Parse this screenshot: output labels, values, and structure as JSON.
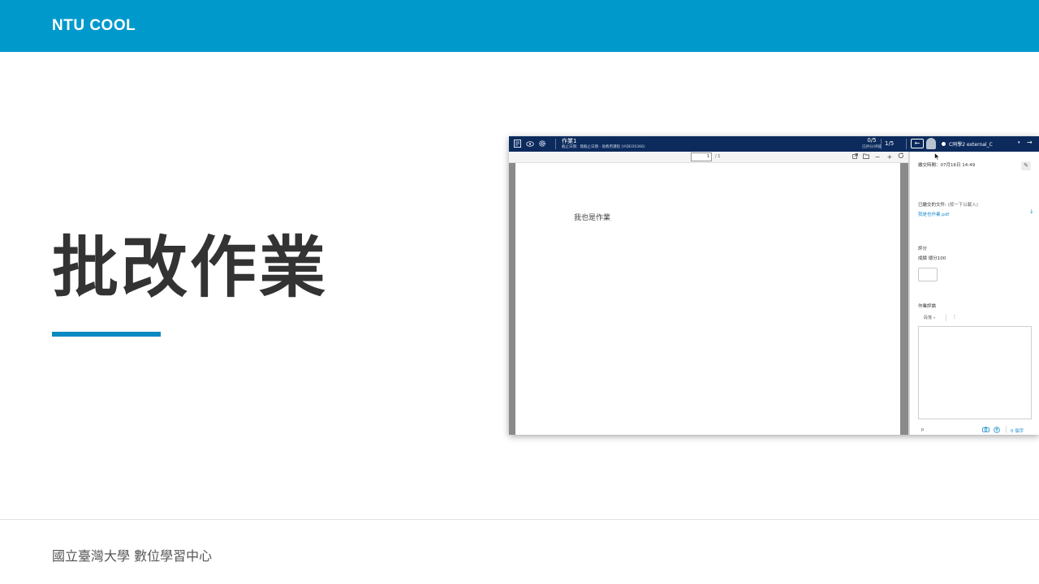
{
  "brand": "NTU COOL",
  "slide": {
    "title": "批改作業",
    "footer": "國立臺灣大學 數位學習中心"
  },
  "screenshot": {
    "header": {
      "icons": [
        "gradebook-icon",
        "eye-icon",
        "settings-icon"
      ],
      "assignment_title": "作業1",
      "assignment_subtitle": "截止日期：無截止日期 - 助教用課程 (VIDEO0366)",
      "graded_count": "0/5",
      "graded_label": "已評分/評論",
      "position": "1/5",
      "prev_arrow": "←",
      "student_name": "C同學2 external_C",
      "student_dropdown": "▾",
      "next_arrow": "→"
    },
    "viewer": {
      "page_input": "1",
      "page_total": "/ 1",
      "toolbar_icons": [
        "open-external-icon",
        "folder-icon",
        "zoom-out-icon",
        "zoom-in-icon",
        "rotate-icon"
      ],
      "document_text": "我也是作業"
    },
    "panel": {
      "submitted_time_label": "繳交時間：",
      "submitted_time": "07月16日 14:49",
      "files_label": "已繳交的文件:",
      "files_hint": "(按一下以載入)",
      "file_name": "我是也作業.pdf",
      "grade_section": "評分",
      "grade_label": "成績",
      "grade_total": "總分100",
      "comments_section": "作業評論",
      "paragraph_select": "段落",
      "editor_tag": "p",
      "word_count": "0 個字"
    }
  }
}
